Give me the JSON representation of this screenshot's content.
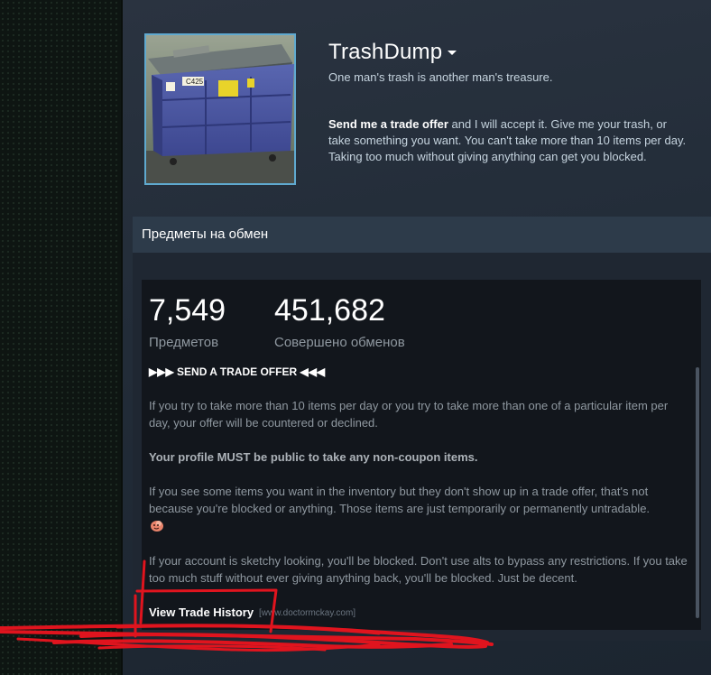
{
  "profile": {
    "persona_name": "TrashDump",
    "motto": "One man's trash is another man's treasure.",
    "summary_bold": "Send me a trade offer",
    "summary_rest": " and I will accept it. Give me your trash, or take something you want. You can't take more than 10 items per day. Taking too much without giving anything can get you blocked.",
    "avatar_label": "C425"
  },
  "showcase": {
    "title": "Предметы на обмен",
    "stats": [
      {
        "value": "7,549",
        "label": "Предметов"
      },
      {
        "value": "451,682",
        "label": "Совершено обменов"
      }
    ],
    "send_offer": "▶▶▶ SEND A TRADE OFFER ◀◀◀",
    "para1": "If you try to take more than 10 items per day or you try to take more than one of a particular item per day, your offer will be countered or declined.",
    "para2": "Your profile MUST be public to take any non-coupon items.",
    "para3": "If you see some items you want in the inventory but they don't show up in a trade offer, that's not because you're blocked or anything. Those items are just temporarily or permanently untradable.",
    "para4": "If your account is sketchy looking, you'll be blocked. Don't use alts to bypass any restrictions. If you take too much stuff without ever giving anything back, you'll be blocked. Just be decent.",
    "view_history": "View Trade History",
    "view_url": "[www.doctormckay.com]"
  },
  "colors": {
    "accent_border": "#5fa9cf",
    "annotation_red": "#e0141e"
  }
}
